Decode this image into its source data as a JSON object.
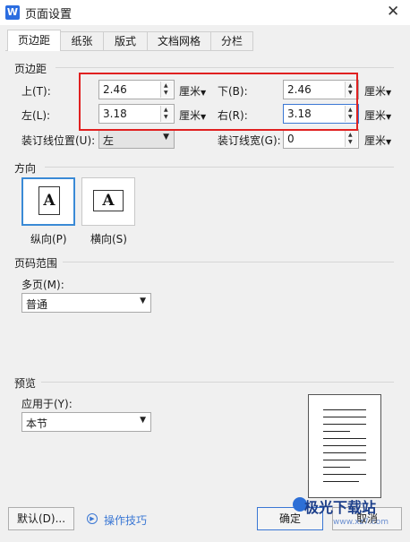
{
  "window": {
    "title": "页面设置",
    "app_icon_letter": "W",
    "close_glyph": "✕"
  },
  "tabs": [
    "页边距",
    "纸张",
    "版式",
    "文档网格",
    "分栏"
  ],
  "margins": {
    "section_title": "页边距",
    "top_label": "上(T):",
    "top_value": "2.46",
    "bottom_label": "下(B):",
    "bottom_value": "2.46",
    "left_label": "左(L):",
    "left_value": "3.18",
    "right_label": "右(R):",
    "right_value": "3.18",
    "unit": "厘米",
    "gutter_pos_label": "装订线位置(U):",
    "gutter_pos_value": "左",
    "gutter_width_label": "装订线宽(G):",
    "gutter_width_value": "0"
  },
  "orientation": {
    "section_title": "方向",
    "portrait_label": "纵向(P)",
    "landscape_label": "横向(S)",
    "icon_letter": "A"
  },
  "page_range": {
    "section_title": "页码范围",
    "multi_label": "多页(M):",
    "multi_value": "普通"
  },
  "preview": {
    "section_title": "预览",
    "apply_label": "应用于(Y):",
    "apply_value": "本节"
  },
  "footer": {
    "default_button": "默认(D)...",
    "tips_link": "操作技巧",
    "ok_button": "确定",
    "cancel_button": "取消"
  },
  "watermark": {
    "text": "极光下载站",
    "url_text": "www.xz7.com"
  },
  "icons": {
    "spin": "spinner-arrows-icon",
    "dropdown": "chevron-down-icon",
    "tips": "play-circle-icon"
  },
  "colors": {
    "accent": "#3a77d4",
    "highlight_box": "#e02020"
  }
}
